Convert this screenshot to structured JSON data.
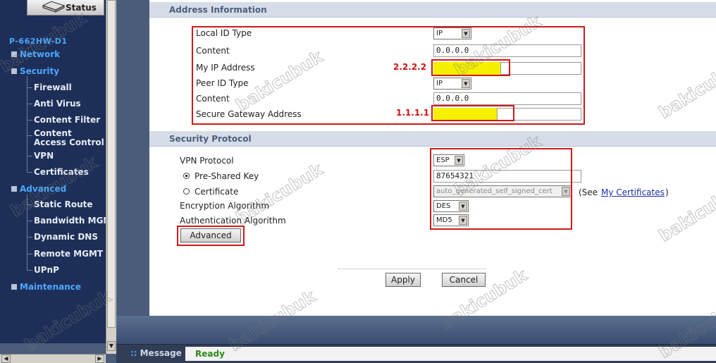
{
  "sidebar": {
    "status_label": "Status",
    "device_name": "P-662HW-D1",
    "network_label": "Network",
    "security_label": "Security",
    "security_items": [
      "Firewall",
      "Anti Virus",
      "Content Filter",
      "Content Access Control",
      "VPN",
      "Certificates"
    ],
    "advanced_label": "Advanced",
    "advanced_items": [
      "Static Route",
      "Bandwidth MGMT",
      "Dynamic DNS",
      "Remote MGMT",
      "UPnP"
    ],
    "maintenance_label": "Maintenance"
  },
  "address": {
    "header": "Address Information",
    "local_id_type_label": "Local ID Type",
    "local_id_type_value": "IP",
    "content_label": "Content",
    "content_value": "0.0.0.0",
    "my_ip_label": "My IP Address",
    "my_ip_annotation": "2.2.2.2",
    "peer_id_type_label": "Peer ID Type",
    "peer_id_type_value": "IP",
    "content2_label": "Content",
    "content2_value": "0.0.0.0",
    "gateway_label": "Secure Gateway Address",
    "gateway_annotation": "1.1.1.1"
  },
  "security_protocol": {
    "header": "Security Protocol",
    "vpn_protocol_label": "VPN Protocol",
    "vpn_protocol_value": "ESP",
    "psk_label": "Pre-Shared Key",
    "psk_value": "87654321",
    "certificate_label": "Certificate",
    "certificate_value": "auto_generated_self_signed_cert",
    "see_prefix": "(See",
    "my_certificates_link": "My Certificates",
    "see_suffix": ")",
    "encryption_label": "Encryption Algorithm",
    "encryption_value": "DES",
    "auth_label": "Authentication Algorithm",
    "auth_value": "MD5",
    "advanced_button": "Advanced"
  },
  "actions": {
    "apply": "Apply",
    "cancel": "Cancel"
  },
  "statusbar": {
    "message_label": "Message",
    "status_text": "Ready"
  },
  "watermark": "bakicubuk",
  "colors": {
    "annotation_red": "#d01818",
    "highlight_yellow": "#f4f000",
    "nav_blue": "#4aa8ff"
  }
}
